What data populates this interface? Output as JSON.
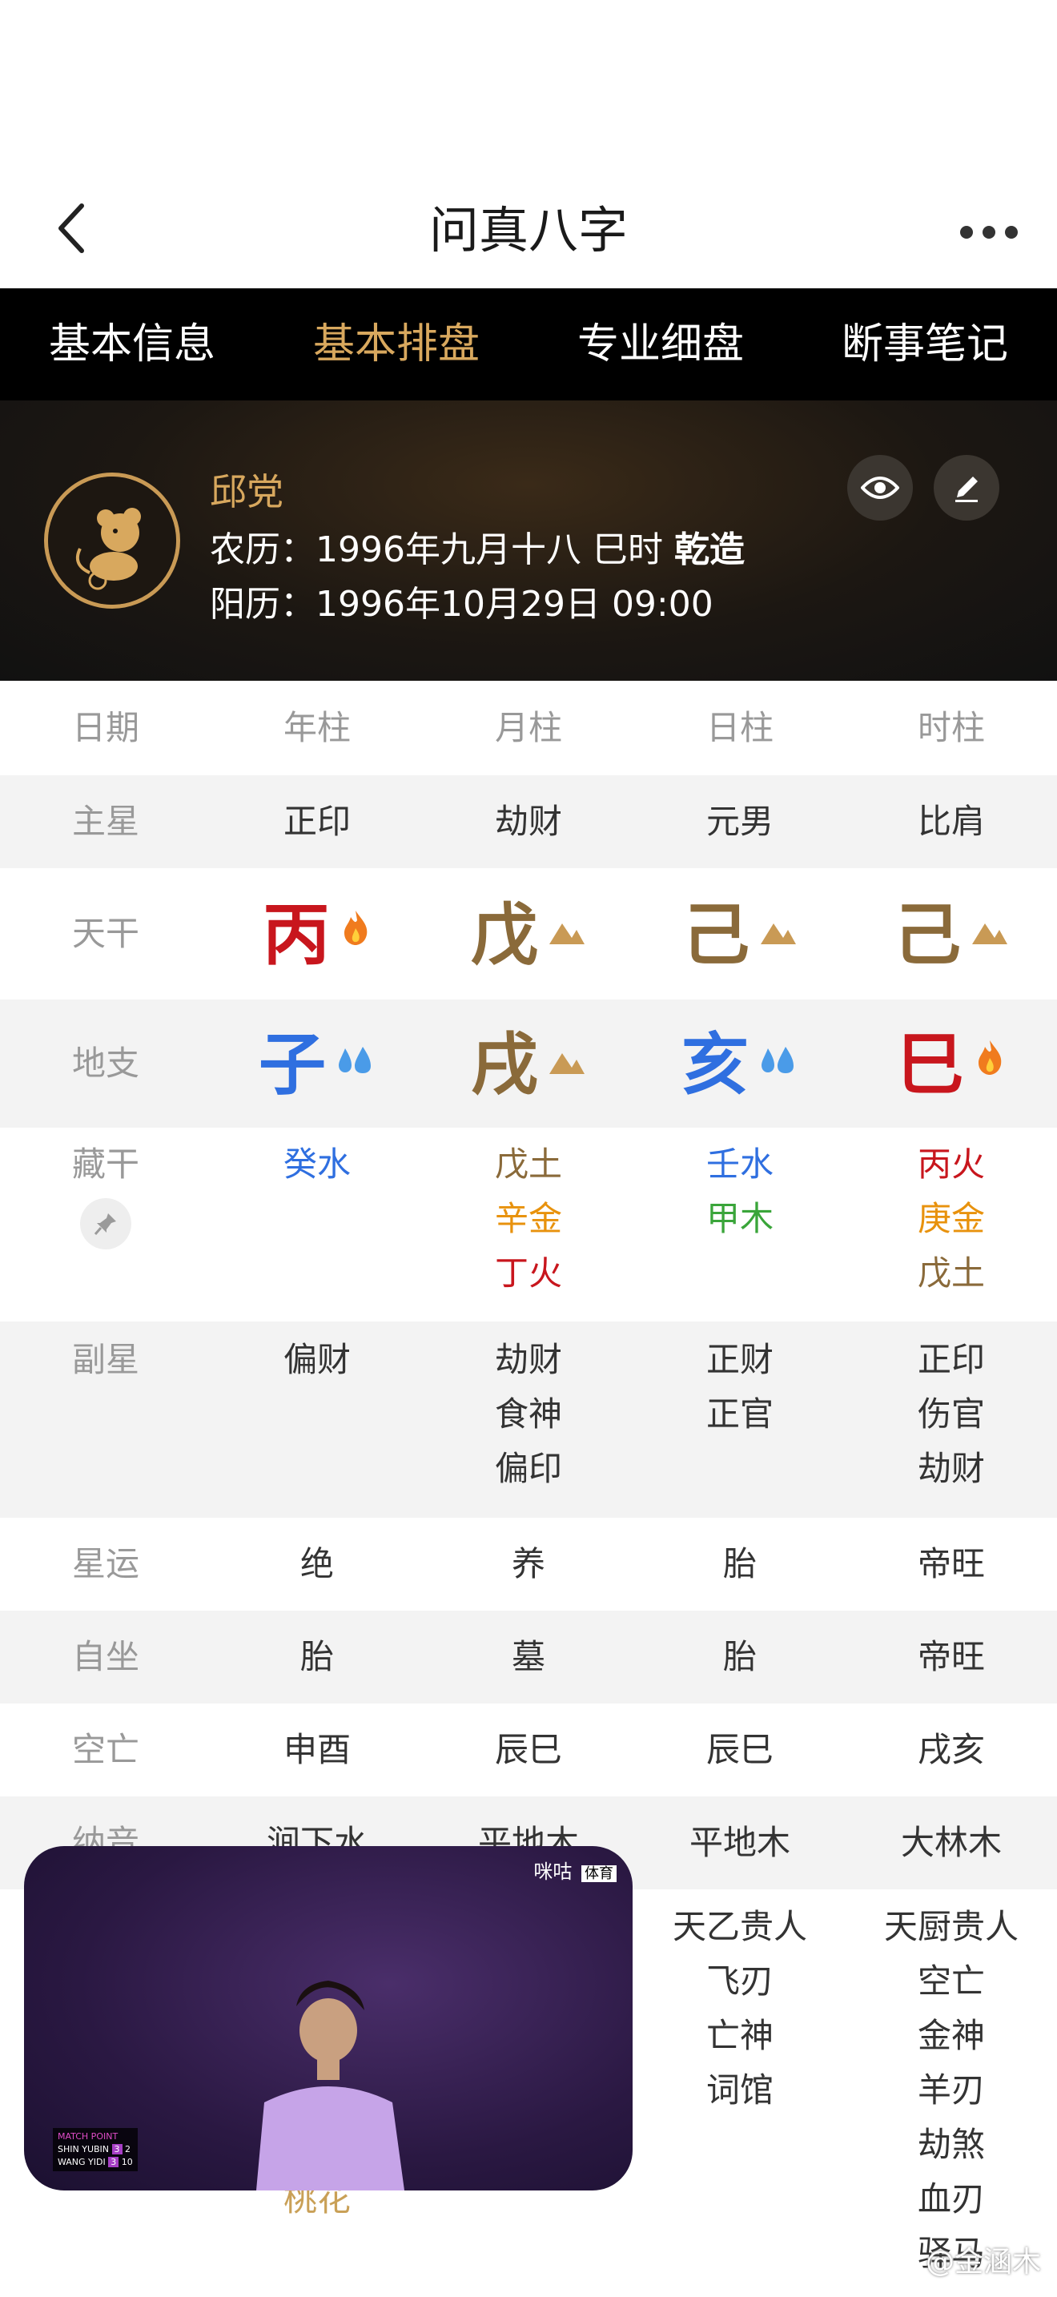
{
  "header": {
    "title": "问真八字"
  },
  "tabs": [
    "基本信息",
    "基本排盘",
    "专业细盘",
    "断事笔记"
  ],
  "active_tab": 1,
  "profile": {
    "name": "邱党",
    "lunar_label": "农历：",
    "lunar_value": "1996年九月十八 巳时",
    "gender_tag": "乾造",
    "solar_label": "阳历：",
    "solar_value": "1996年10月29日 09:00"
  },
  "columns": [
    "日期",
    "年柱",
    "月柱",
    "日柱",
    "时柱"
  ],
  "main_star": {
    "label": "主星",
    "values": [
      "正印",
      "劫财",
      "元男",
      "比肩"
    ]
  },
  "tiangan": {
    "label": "天干",
    "values": [
      "丙",
      "戊",
      "己",
      "己"
    ],
    "elements": [
      "fire-icon",
      "earth-icon",
      "earth-icon",
      "earth-icon"
    ]
  },
  "dizhi": {
    "label": "地支",
    "values": [
      "子",
      "戌",
      "亥",
      "巳"
    ],
    "elements": [
      "water-icon",
      "earth-icon",
      "water-icon",
      "fire-icon"
    ]
  },
  "canggan": {
    "label": "藏干",
    "values": [
      [
        "癸水"
      ],
      [
        "戊土",
        "辛金",
        "丁火"
      ],
      [
        "壬水",
        "甲木"
      ],
      [
        "丙火",
        "庚金",
        "戊土"
      ]
    ]
  },
  "fuxing": {
    "label": "副星",
    "values": [
      [
        "偏财"
      ],
      [
        "劫财",
        "食神",
        "偏印"
      ],
      [
        "正财",
        "正官"
      ],
      [
        "正印",
        "伤官",
        "劫财"
      ]
    ]
  },
  "xingyun": {
    "label": "星运",
    "values": [
      "绝",
      "养",
      "胎",
      "帝旺"
    ]
  },
  "zizuo": {
    "label": "自坐",
    "values": [
      "胎",
      "墓",
      "胎",
      "帝旺"
    ]
  },
  "kongwang": {
    "label": "空亡",
    "values": [
      "申酉",
      "辰巳",
      "辰巳",
      "戌亥"
    ]
  },
  "nayin": {
    "label": "纳音",
    "values": [
      "涧下水",
      "平地木",
      "平地木",
      "大林木"
    ]
  },
  "shensha": {
    "values": [
      [
        "桃花"
      ],
      [],
      [
        "天乙贵人",
        "飞刃",
        "亡神",
        "词馆"
      ],
      [
        "天厨贵人",
        "空亡",
        "金神",
        "羊刃",
        "劫煞",
        "血刃",
        "驿马"
      ]
    ]
  },
  "video": {
    "brand": "咪咕",
    "badge": "体育",
    "tag": "MATCH POINT",
    "p1": "SHIN YUBIN",
    "p2": "WANG YIDI",
    "s1": [
      "3",
      "2"
    ],
    "s2": [
      "3",
      "10"
    ]
  },
  "watermark": "@金涵木",
  "colors": {
    "gold": "#d8a85e",
    "fire": "#c8161d",
    "earth": "#8a6a3a",
    "water": "#2f6fe0",
    "metal": "#e8920d",
    "wood": "#3aa53a"
  }
}
